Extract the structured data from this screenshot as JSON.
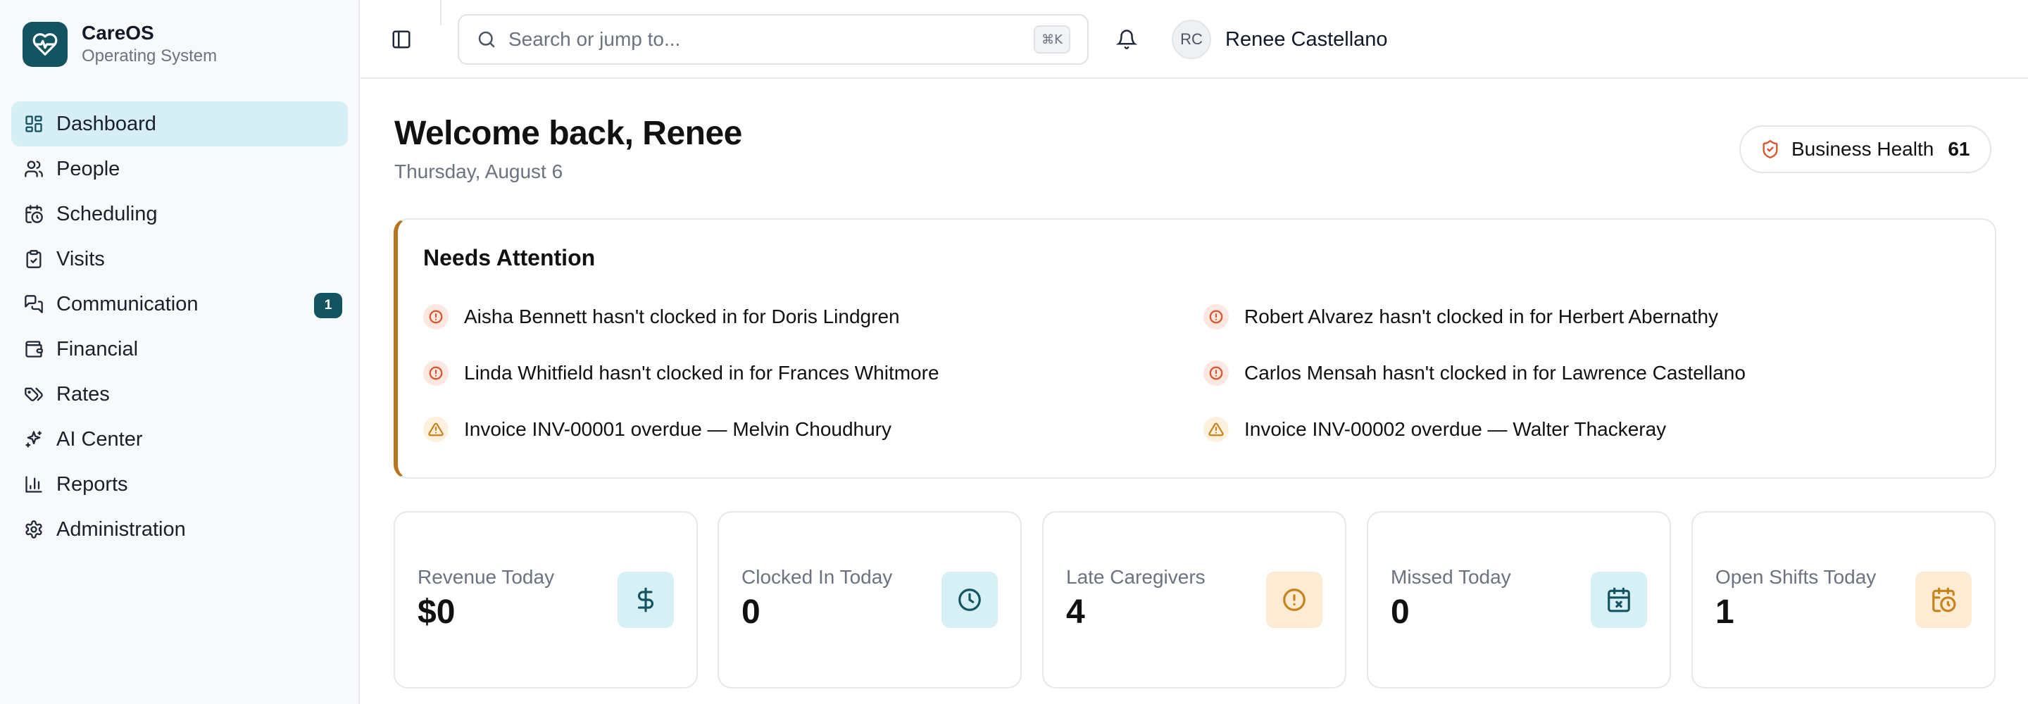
{
  "brand": {
    "name": "CareOS",
    "subtitle": "Operating System"
  },
  "nav": [
    {
      "label": "Dashboard",
      "icon": "dashboard-icon",
      "active": true
    },
    {
      "label": "People",
      "icon": "people-icon"
    },
    {
      "label": "Scheduling",
      "icon": "scheduling-icon"
    },
    {
      "label": "Visits",
      "icon": "visits-icon"
    },
    {
      "label": "Communication",
      "icon": "communication-icon",
      "badge": "1"
    },
    {
      "label": "Financial",
      "icon": "wallet-icon"
    },
    {
      "label": "Rates",
      "icon": "tag-icon"
    },
    {
      "label": "AI Center",
      "icon": "sparkles-icon"
    },
    {
      "label": "Reports",
      "icon": "bar-chart-icon"
    },
    {
      "label": "Administration",
      "icon": "gear-icon"
    }
  ],
  "topbar": {
    "search_placeholder": "Search or jump to...",
    "search_shortcut": "⌘K",
    "user": {
      "initials": "RC",
      "name": "Renee Castellano"
    }
  },
  "main": {
    "welcome": "Welcome back, Renee",
    "date": "Thursday, August 6",
    "health": {
      "label": "Business Health",
      "value": "61"
    }
  },
  "attention": {
    "title": "Needs Attention",
    "items": [
      {
        "text": "Aisha Bennett hasn't clocked in for Doris Lindgren",
        "type": "error"
      },
      {
        "text": "Robert Alvarez hasn't clocked in for Herbert Abernathy",
        "type": "error"
      },
      {
        "text": "Linda Whitfield hasn't clocked in for Frances Whitmore",
        "type": "error"
      },
      {
        "text": "Carlos Mensah hasn't clocked in for Lawrence Castellano",
        "type": "error"
      },
      {
        "text": "Invoice INV-00001 overdue — Melvin Choudhury",
        "type": "warning"
      },
      {
        "text": "Invoice INV-00002 overdue — Walter Thackeray",
        "type": "warning"
      }
    ]
  },
  "stats": [
    {
      "label": "Revenue Today",
      "value": "$0",
      "icon": "dollar-icon",
      "tone": "teal"
    },
    {
      "label": "Clocked In Today",
      "value": "0",
      "icon": "clock-icon",
      "tone": "teal"
    },
    {
      "label": "Late Caregivers",
      "value": "4",
      "icon": "alert-circle-icon",
      "tone": "amber"
    },
    {
      "label": "Missed Today",
      "value": "0",
      "icon": "calendar-x-icon",
      "tone": "teal"
    },
    {
      "label": "Open Shifts Today",
      "value": "1",
      "icon": "calendar-clock-icon",
      "tone": "amber"
    }
  ],
  "colors": {
    "primary": "#135462",
    "active_bg": "#d6eff5",
    "attention_accent": "#b8741c",
    "error": "#d9532c",
    "warning": "#c8821a"
  }
}
